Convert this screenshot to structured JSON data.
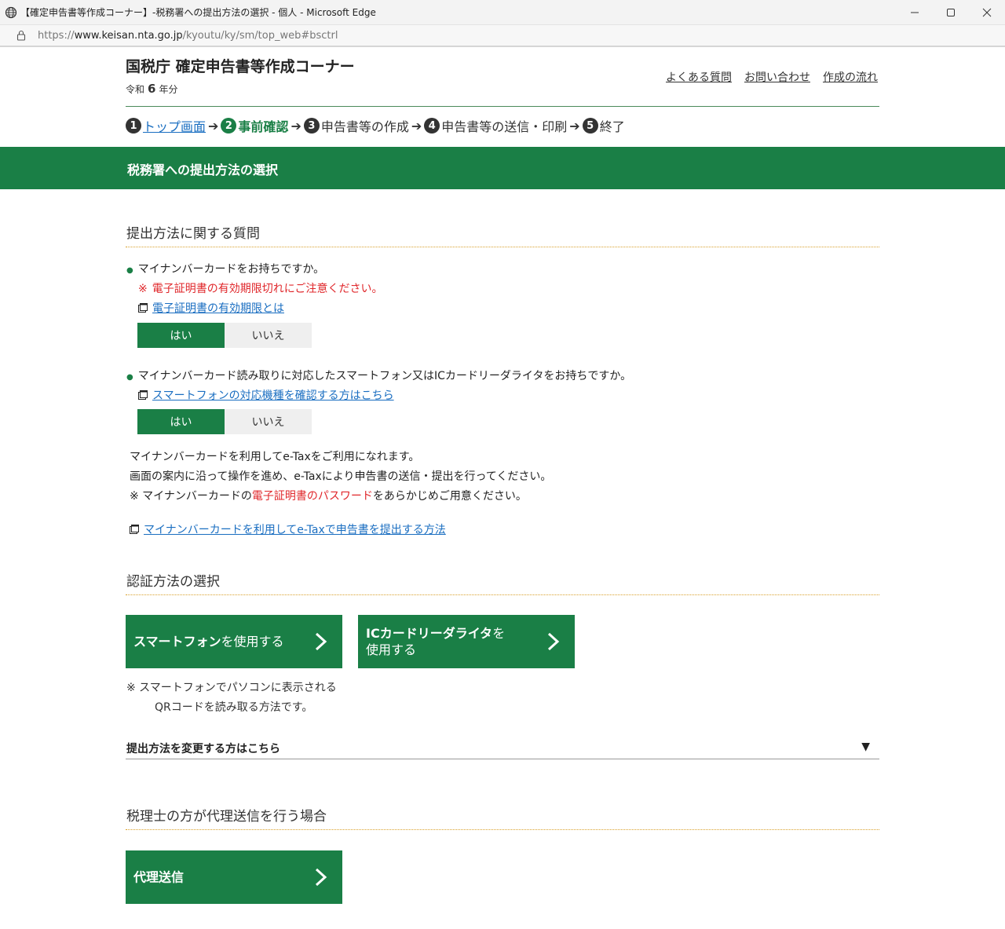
{
  "window": {
    "title": "【確定申告書等作成コーナー】-税務署への提出方法の選択 - 個人 - Microsoft Edge",
    "url_prefix": "https://",
    "url_host": "www.keisan.nta.go.jp",
    "url_path": "/kyoutu/ky/sm/top_web#bsctrl"
  },
  "header": {
    "site_title": "国税庁 確定申告書等作成コーナー",
    "era_prefix": "令和",
    "era_year": "6",
    "era_suffix": "年分",
    "links": [
      "よくある質問",
      "お問い合わせ",
      "作成の流れ"
    ]
  },
  "steps": [
    {
      "num": "1",
      "label": "トップ画面"
    },
    {
      "num": "2",
      "label": "事前確認"
    },
    {
      "num": "3",
      "label": "申告書等の作成"
    },
    {
      "num": "4",
      "label": "申告書等の送信・印刷"
    },
    {
      "num": "5",
      "label": "終了"
    }
  ],
  "steps_arrow": "➔",
  "banner_title": "税務署への提出方法の選択",
  "section1": {
    "title": "提出方法に関する質問",
    "q1": {
      "bullet": "●",
      "text": "マイナンバーカードをお持ちですか。",
      "warn_mark": "※",
      "warn": "電子証明書の有効期限切れにご注意ください。",
      "link": "電子証明書の有効期限とは",
      "yes": "はい",
      "no": "いいえ"
    },
    "q2": {
      "bullet": "●",
      "text": "マイナンバーカード読み取りに対応したスマートフォン又はICカードリーダライタをお持ちですか。",
      "link": "スマートフォンの対応機種を確認する方はこちら",
      "yes": "はい",
      "no": "いいえ"
    },
    "info_line1": "マイナンバーカードを利用してe-Taxをご利用になれます。",
    "info_line2": "画面の案内に沿って操作を進め、e-Taxにより申告書の送信・提出を行ってください。",
    "info_line3_a": "※  マイナンバーカードの",
    "info_line3_red": "電子証明書のパスワード",
    "info_line3_b": "をあらかじめご用意ください。",
    "info_link": "マイナンバーカードを利用してe-Taxで申告書を提出する方法"
  },
  "section2": {
    "title": "認証方法の選択",
    "btn_smartphone_bold": "スマートフォン",
    "btn_smartphone_rest": "を使用する",
    "btn_ic_bold": "ICカードリーダライタ",
    "btn_ic_rest1": "を",
    "btn_ic_rest2": "使用する",
    "note_line1": "※  スマートフォンでパソコンに表示される",
    "note_line2": "QRコードを読み取る方法です。",
    "collapse_label": "提出方法を変更する方はこちら",
    "collapse_icon": "▼"
  },
  "section3": {
    "title": "税理士の方が代理送信を行う場合",
    "btn_proxy": "代理送信"
  },
  "colors": {
    "brand_green": "#1a7f46",
    "link_blue": "#1a6ec1",
    "warning_red": "#e0272b",
    "dotted_gold": "#d9a12c"
  }
}
